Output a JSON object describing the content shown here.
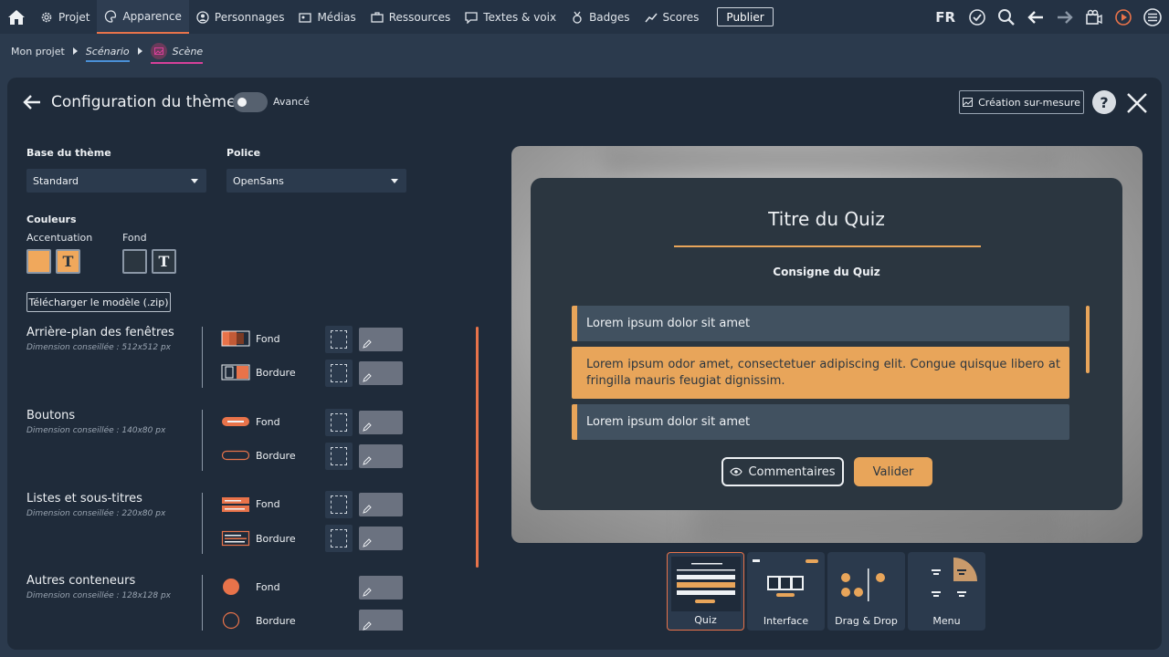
{
  "nav": {
    "items": [
      {
        "label": "Projet",
        "icon": "gear-icon"
      },
      {
        "label": "Apparence",
        "icon": "palette-icon",
        "active": true
      },
      {
        "label": "Personnages",
        "icon": "person-icon"
      },
      {
        "label": "Médias",
        "icon": "media-icon"
      },
      {
        "label": "Ressources",
        "icon": "briefcase-icon"
      },
      {
        "label": "Textes & voix",
        "icon": "speech-icon"
      },
      {
        "label": "Badges",
        "icon": "badge-icon"
      },
      {
        "label": "Scores",
        "icon": "chart-icon"
      }
    ],
    "publish_label": "Publier",
    "lang": "FR"
  },
  "breadcrumb": {
    "project": "Mon projet",
    "scenario": "Scénario",
    "scene": "Scène"
  },
  "panel": {
    "title": "Configuration du thème",
    "toggle_label": "Avancé",
    "toggle_on": false,
    "custom_label": "Création sur-mesure",
    "help_label": "?"
  },
  "theme": {
    "base_label": "Base du thème",
    "base_value": "Standard",
    "font_label": "Police",
    "font_value": "OpenSans",
    "colors_label": "Couleurs",
    "accent_label": "Accentuation",
    "background_label": "Fond",
    "accent_color": "#f0a85c",
    "background_color": "#2b3640",
    "text_glyph": "T",
    "download_label": "Télécharger le modèle (.zip)"
  },
  "sections": [
    {
      "title": "Arrière-plan des fenêtres",
      "dimension": "Dimension conseillée : 512x512 px",
      "rows": [
        "Fond",
        "Bordure"
      ]
    },
    {
      "title": "Boutons",
      "dimension": "Dimension conseillée : 140x80 px",
      "rows": [
        "Fond",
        "Bordure"
      ]
    },
    {
      "title": "Listes et sous-titres",
      "dimension": "Dimension conseillée : 220x80 px",
      "rows": [
        "Fond",
        "Bordure"
      ]
    },
    {
      "title": "Autres conteneurs",
      "dimension": "Dimension conseillée : 128x128 px",
      "rows": [
        "Fond",
        "Bordure"
      ]
    }
  ],
  "preview": {
    "quiz_title": "Titre du Quiz",
    "quiz_instruction": "Consigne du Quiz",
    "answers": [
      "Lorem ipsum dolor sit amet",
      "Lorem ipsum odor amet, consectetuer adipiscing elit. Congue quisque libero at fringilla mauris feugiat dignissim.",
      "Lorem ipsum dolor sit amet"
    ],
    "selected_answer_index": 1,
    "comment_label": "Commentaires",
    "validate_label": "Valider"
  },
  "templates": [
    {
      "label": "Quiz",
      "active": true
    },
    {
      "label": "Interface"
    },
    {
      "label": "Drag & Drop"
    },
    {
      "label": "Menu"
    }
  ],
  "colors": {
    "orange": "#e8734a",
    "accent": "#e8a55a"
  }
}
